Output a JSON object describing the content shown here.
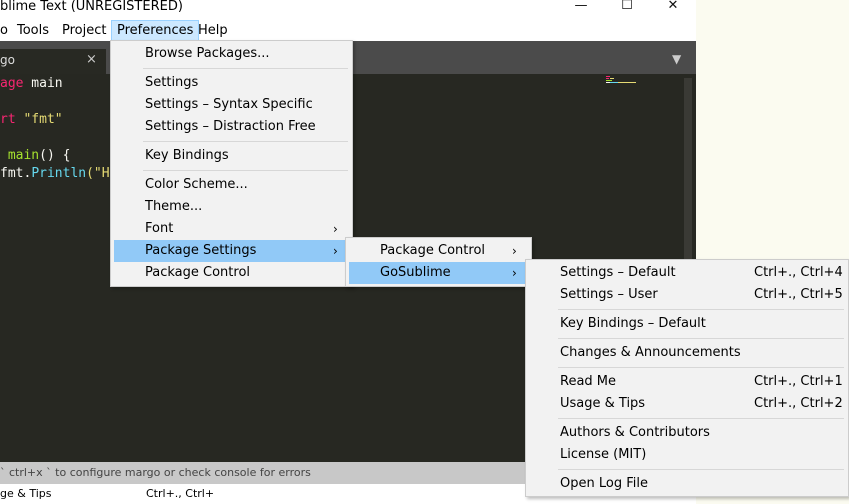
{
  "window": {
    "title": "blime Text (UNREGISTERED)",
    "controls": {
      "minimize": "—",
      "maximize": "☐",
      "close": "✕"
    }
  },
  "menubar": {
    "items": [
      {
        "label": "o"
      },
      {
        "label": "Tools"
      },
      {
        "label": "Project"
      },
      {
        "label": "Preferences"
      },
      {
        "label": "Help"
      }
    ]
  },
  "tab": {
    "label": "go",
    "close": "×",
    "dropdown": "▼"
  },
  "code": {
    "line1": {
      "kw": "age",
      "rest": " main"
    },
    "line2": {
      "kw": "rt",
      "str": "\"fmt\""
    },
    "line3": {
      "fn": "main",
      "rest": "() {"
    },
    "line4": {
      "pre": "fmt.",
      "ty": "Println",
      "rest": "(\"H"
    }
  },
  "status": {
    "text": "` ctrl+x ` to configure margo or check console for errors"
  },
  "console": {
    "left": "ge & Tips",
    "right": "Ctrl+., Ctrl+"
  },
  "preferences_menu": {
    "items": [
      {
        "label": "Browse Packages..."
      },
      {
        "label": "Settings"
      },
      {
        "label": "Settings – Syntax Specific"
      },
      {
        "label": "Settings – Distraction Free"
      },
      {
        "label": "Key Bindings"
      },
      {
        "label": "Color Scheme..."
      },
      {
        "label": "Theme..."
      },
      {
        "label": "Font",
        "arrow": "›"
      },
      {
        "label": "Package Settings",
        "arrow": "›"
      },
      {
        "label": "Package Control"
      }
    ]
  },
  "package_settings_menu": {
    "items": [
      {
        "label": "Package Control",
        "arrow": "›"
      },
      {
        "label": "GoSublime",
        "arrow": "›"
      }
    ]
  },
  "gosublime_menu": {
    "items": [
      {
        "label": "Settings – Default",
        "shortcut": "Ctrl+., Ctrl+4"
      },
      {
        "label": "Settings – User",
        "shortcut": "Ctrl+., Ctrl+5"
      },
      {
        "label": "Key Bindings – Default"
      },
      {
        "label": "Changes & Announcements"
      },
      {
        "label": "Read Me",
        "shortcut": "Ctrl+., Ctrl+1"
      },
      {
        "label": "Usage & Tips",
        "shortcut": "Ctrl+., Ctrl+2"
      },
      {
        "label": "Authors & Contributors"
      },
      {
        "label": "License (MIT)"
      },
      {
        "label": "Open Log File"
      }
    ]
  }
}
